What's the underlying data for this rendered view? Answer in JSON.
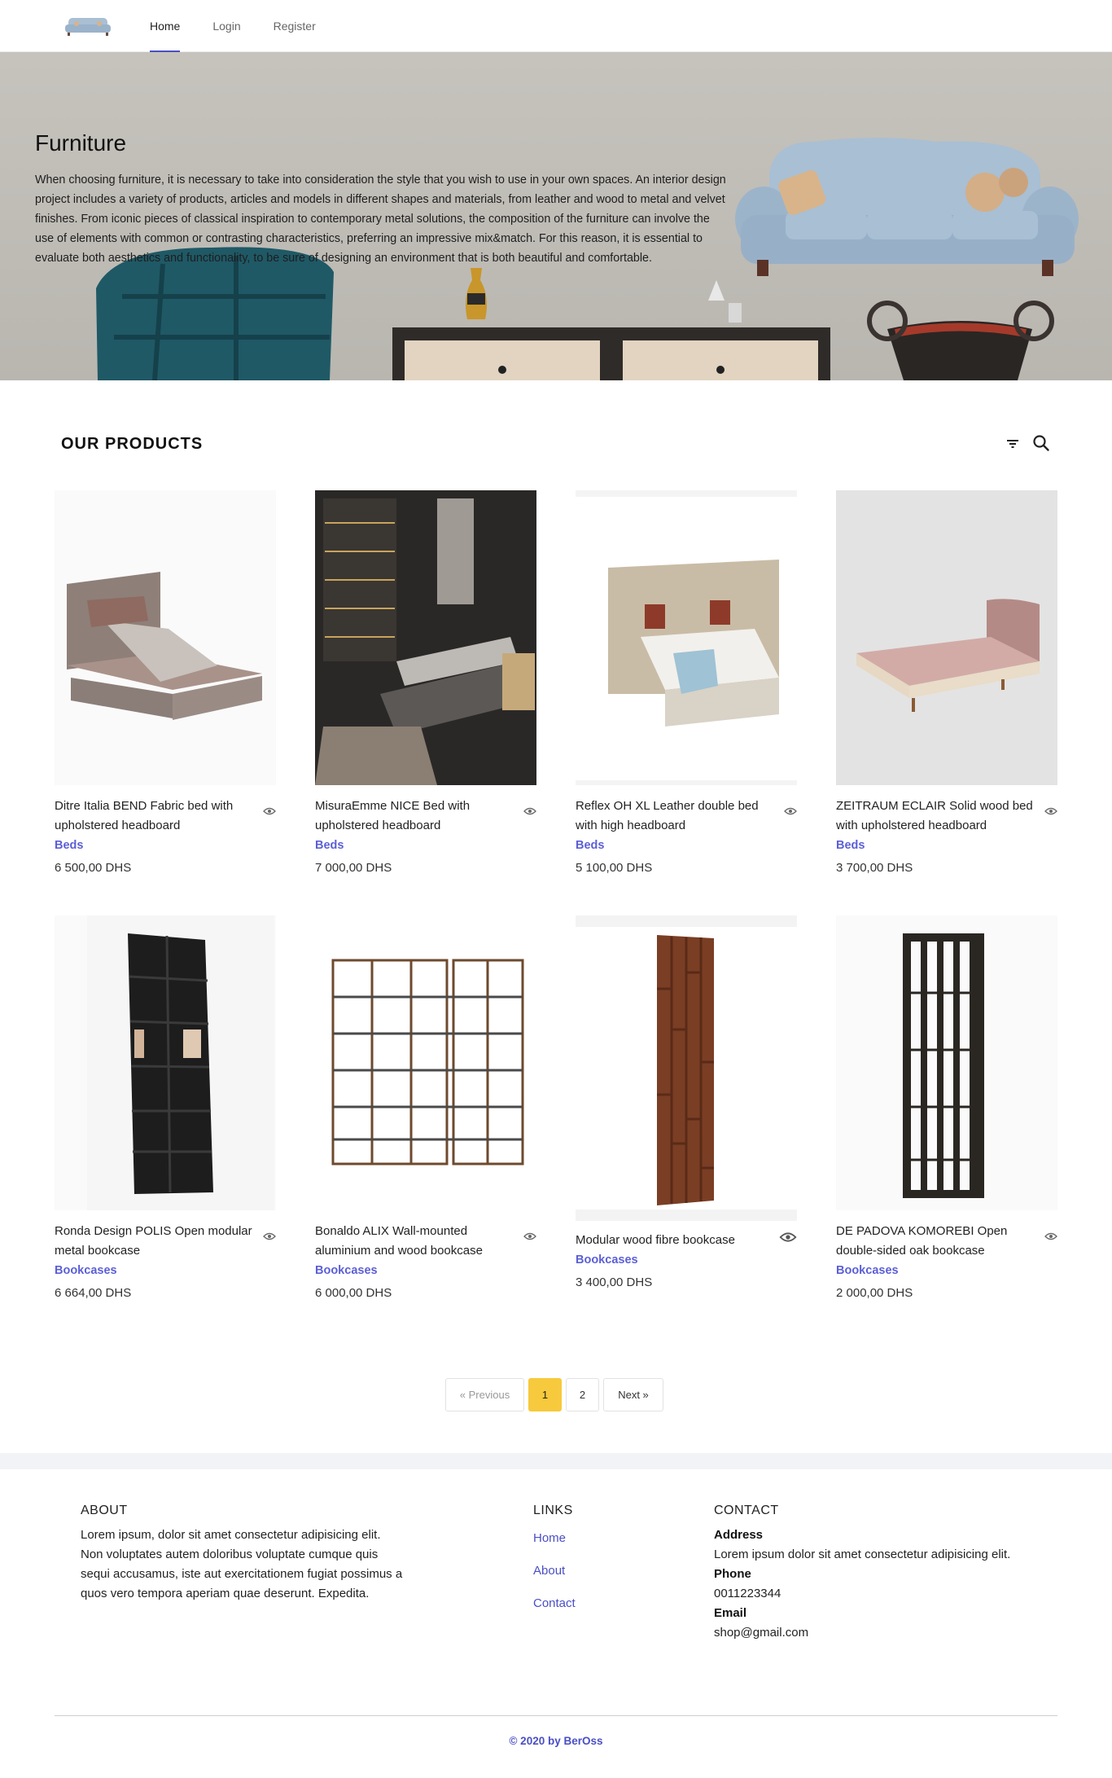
{
  "nav": {
    "links": [
      {
        "label": "Home",
        "active": true
      },
      {
        "label": "Login",
        "active": false
      },
      {
        "label": "Register",
        "active": false
      }
    ]
  },
  "hero": {
    "title": "Furniture",
    "text": "When choosing furniture, it is necessary to take into consideration the style that you wish to use in your own spaces. An interior design project includes a variety of products, articles and models in different shapes and materials, from leather and wood to metal and velvet finishes. From iconic pieces of classical inspiration to contemporary metal solutions, the composition of the furniture can involve the use of elements with common or contrasting characteristics, preferring an impressive mix&match. For this reason, it is essential to evaluate both aesthetics and functionality, to be sure of designing an environment that is both beautiful and comfortable."
  },
  "products": {
    "title": "OUR PRODUCTS",
    "items": [
      {
        "name": "Ditre Italia BEND Fabric bed with upholstered headboard",
        "category": "Beds",
        "price": "6 500,00 DHS"
      },
      {
        "name": "MisuraEmme NICE Bed with upholstered headboard",
        "category": "Beds",
        "price": "7 000,00 DHS"
      },
      {
        "name": "Reflex OH XL Leather double bed with high headboard",
        "category": "Beds",
        "price": "5 100,00 DHS"
      },
      {
        "name": "ZEITRAUM ECLAIR Solid wood bed with upholstered headboard",
        "category": "Beds",
        "price": "3 700,00 DHS"
      },
      {
        "name": "Ronda Design POLIS Open modular metal bookcase",
        "category": "Bookcases",
        "price": "6 664,00 DHS"
      },
      {
        "name": "Bonaldo ALIX Wall-mounted aluminium and wood bookcase",
        "category": "Bookcases",
        "price": "6 000,00 DHS"
      },
      {
        "name": "Modular wood fibre bookcase",
        "category": "Bookcases",
        "price": "3 400,00 DHS"
      },
      {
        "name": "DE PADOVA KOMOREBI Open double-sided oak bookcase",
        "category": "Bookcases",
        "price": "2 000,00 DHS"
      }
    ]
  },
  "pagination": {
    "prev": "« Previous",
    "pages": [
      "1",
      "2"
    ],
    "active": "1",
    "next": "Next »"
  },
  "footer": {
    "about": {
      "heading": "ABOUT",
      "text": "Lorem ipsum, dolor sit amet consectetur adipisicing elit. Non voluptates autem doloribus voluptate cumque quis sequi accusamus, iste aut exercitationem fugiat possimus a quos vero tempora aperiam quae deserunt. Expedita."
    },
    "links": {
      "heading": "LINKS",
      "items": [
        "Home",
        "About",
        "Contact"
      ]
    },
    "contact": {
      "heading": "CONTACT",
      "address_label": "Address",
      "address": "Lorem ipsum dolor sit amet consectetur adipisicing elit.",
      "phone_label": "Phone",
      "phone": "0011223344",
      "email_label": "Email",
      "email": "shop@gmail.com"
    },
    "copyright": "© 2020 by BerOss"
  },
  "colors": {
    "accent": "#4a4fc4",
    "category": "#5b5fd6",
    "active_page": "#f7c93c",
    "hero_bg": "#c2bfb9"
  }
}
